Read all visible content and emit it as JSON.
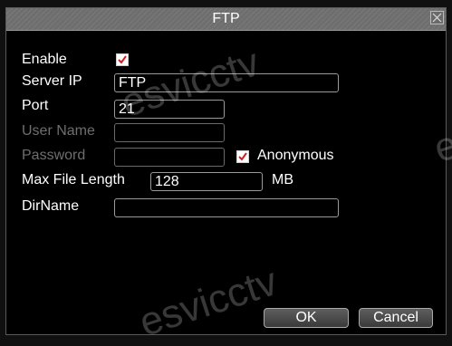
{
  "dialog": {
    "title": "FTP"
  },
  "form": {
    "enable_label": "Enable",
    "enable_checked": true,
    "server_ip_label": "Server IP",
    "server_ip_value": "FTP",
    "port_label": "Port",
    "port_value": "21",
    "user_name_label": "User Name",
    "user_name_value": "",
    "password_label": "Password",
    "password_value": "",
    "anonymous_label": "Anonymous",
    "anonymous_checked": true,
    "max_file_length_label": "Max File Length",
    "max_file_length_value": "128",
    "max_file_length_unit": "MB",
    "dirname_label": "DirName",
    "dirname_value": ""
  },
  "buttons": {
    "ok_label": "OK",
    "cancel_label": "Cancel"
  },
  "watermark": {
    "text": "esvicctv"
  },
  "colors": {
    "check_mark": "#cc2222",
    "disabled_text": "#6e6e6e"
  }
}
